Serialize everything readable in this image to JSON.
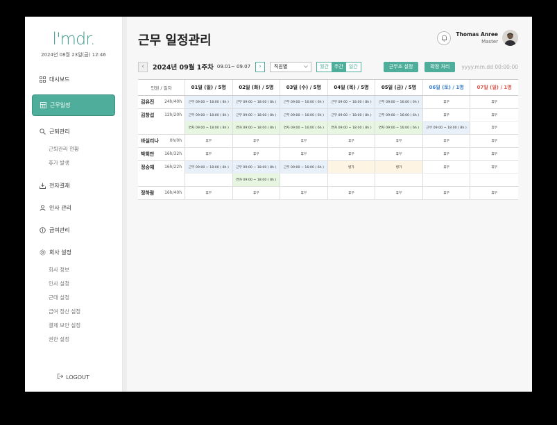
{
  "sidebar": {
    "logo": "l'mdr.",
    "datetime": "2024년 08월 23일(금) 12:46",
    "items": [
      {
        "label": "대시보드"
      },
      {
        "label": "근무일정"
      },
      {
        "label": "근퇴관리"
      },
      {
        "label": "전자결재"
      },
      {
        "label": "인사 관리"
      },
      {
        "label": "급여관리"
      },
      {
        "label": "회사 설정"
      }
    ],
    "attendance_sub": [
      "근퇴관리 현황",
      "휴가 발생"
    ],
    "company_sub": [
      "회사 정보",
      "인사 설정",
      "근태 설정",
      "급여 정산 설정",
      "결제 보안 설정",
      "권한 설정"
    ],
    "logout": "LOGOUT"
  },
  "header": {
    "title": "근무 일정관리",
    "user_name": "Thomas Anree",
    "user_role": "Master"
  },
  "toolbar": {
    "week_title": "2024년 09월 1주차",
    "week_range": "09.01~ 09.07",
    "filter_value": "직원별",
    "view_modes": [
      "월간",
      "주간",
      "일간"
    ],
    "selected_view": "주간",
    "btn_group_settings": "근무조 설정",
    "btn_confirm": "확정 처리",
    "date_placeholder": "yyyy.mm.dd 00:00:00"
  },
  "table": {
    "corner": "인원 / 일자",
    "days": [
      "01일 (일) / 5명",
      "02일 (화) / 5명",
      "03일 (수) / 5명",
      "04일 (목) / 5명",
      "05일 (금) / 5명",
      "06일 (토) / 1명",
      "07일 (일) / 1명"
    ],
    "people": [
      {
        "name": "김유진",
        "hours": "24h/40h",
        "rows": [
          [
            {
              "t": "근무 09:00 ~ 18:00 ( 8h )",
              "k": "work"
            },
            {
              "t": "근무 09:00 ~ 18:00 ( 8h )",
              "k": "work"
            },
            {
              "t": "근무 09:00 ~ 16:00 ( 6h )",
              "k": "work"
            },
            {
              "t": "근무 09:00 ~ 18:00 ( 8h )",
              "k": "work"
            },
            {
              "t": "근무 09:00 ~ 16:00 ( 6h )",
              "k": "work"
            },
            {
              "t": "휴무",
              "k": "off"
            },
            {
              "t": "휴무",
              "k": "off"
            }
          ]
        ]
      },
      {
        "name": "김창섭",
        "hours": "12h/20h",
        "rows": [
          [
            {
              "t": "근무 09:00 ~ 18:00 ( 8h )",
              "k": "work"
            },
            {
              "t": "근무 09:00 ~ 18:00 ( 8h )",
              "k": "work"
            },
            {
              "t": "근무 09:00 ~ 16:00 ( 6h )",
              "k": "work"
            },
            {
              "t": "근무 09:00 ~ 18:00 ( 8h )",
              "k": "work"
            },
            {
              "t": "근무 09:00 ~ 16:00 ( 6h )",
              "k": "work"
            },
            {
              "t": "휴무",
              "k": "off"
            },
            {
              "t": "휴무",
              "k": "off"
            }
          ],
          [
            {
              "t": "연차 09:00 ~ 18:00 ( 8h )",
              "k": "extra"
            },
            {
              "t": "연차 09:00 ~ 18:00 ( 8h )",
              "k": "extra"
            },
            {
              "t": "연차 09:00 ~ 16:00 ( 6h )",
              "k": "extra"
            },
            {
              "t": "연차 09:00 ~ 18:00 ( 8h )",
              "k": "extra"
            },
            {
              "t": "연차 09:00 ~ 16:00 ( 6h )",
              "k": "extra"
            },
            {
              "t": "근무 09:00 ~ 18:00 ( 8h )",
              "k": "work"
            },
            {
              "t": "휴무",
              "k": "off"
            }
          ]
        ]
      },
      {
        "name": "바실리나",
        "hours": "0h/0h",
        "rows": [
          [
            {
              "t": "휴무",
              "k": "off"
            },
            {
              "t": "휴무",
              "k": "off"
            },
            {
              "t": "휴무",
              "k": "off"
            },
            {
              "t": "휴무",
              "k": "off"
            },
            {
              "t": "휴무",
              "k": "off"
            },
            {
              "t": "휴무",
              "k": "off"
            },
            {
              "t": "휴무",
              "k": "off"
            }
          ]
        ]
      },
      {
        "name": "박희만",
        "hours": "16h/32h",
        "rows": [
          [
            {
              "t": "휴무",
              "k": "off"
            },
            {
              "t": "휴무",
              "k": "off"
            },
            {
              "t": "휴무",
              "k": "off"
            },
            {
              "t": "휴무",
              "k": "off"
            },
            {
              "t": "휴무",
              "k": "off"
            },
            {
              "t": "휴무",
              "k": "off"
            },
            {
              "t": "휴무",
              "k": "off"
            }
          ]
        ]
      },
      {
        "name": "정승재",
        "hours": "16h/22h",
        "rows": [
          [
            {
              "t": "근무 09:00 ~ 18:00 ( 8h )",
              "k": "work"
            },
            {
              "t": "근무 09:00 ~ 18:00 ( 8h )",
              "k": "work"
            },
            {
              "t": "근무 09:00 ~ 16:00 ( 6h )",
              "k": "work"
            },
            {
              "t": "병가",
              "k": "leave"
            },
            {
              "t": "병가",
              "k": "leave"
            },
            {
              "t": "휴무",
              "k": "off"
            },
            {
              "t": "휴무",
              "k": "off"
            }
          ],
          [
            {
              "t": "",
              "k": "empty"
            },
            {
              "t": "연차 09:00 ~ 18:00 ( 8h )",
              "k": "extra"
            },
            {
              "t": "",
              "k": "empty"
            },
            {
              "t": "",
              "k": "empty"
            },
            {
              "t": "",
              "k": "empty"
            },
            {
              "t": "",
              "k": "empty"
            },
            {
              "t": "",
              "k": "empty"
            }
          ]
        ]
      },
      {
        "name": "정하람",
        "hours": "16h/40h",
        "rows": [
          [
            {
              "t": "휴무",
              "k": "off"
            },
            {
              "t": "휴무",
              "k": "off"
            },
            {
              "t": "휴무",
              "k": "off"
            },
            {
              "t": "휴무",
              "k": "off"
            },
            {
              "t": "휴무",
              "k": "off"
            },
            {
              "t": "휴무",
              "k": "off"
            },
            {
              "t": "휴무",
              "k": "off"
            }
          ]
        ]
      }
    ]
  },
  "colors": {
    "accent": "#4fae9b",
    "work_cell": "#e8f0f9",
    "extra_cell": "#e6f6e1",
    "leave_cell": "#fdf4e3",
    "saturday": "#3a7ec9",
    "sunday": "#e2554b"
  }
}
